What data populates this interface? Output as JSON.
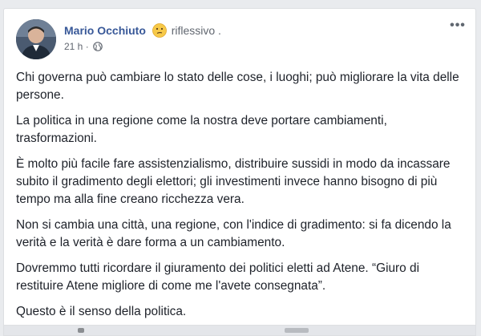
{
  "post": {
    "author": "Mario Occhiuto",
    "feeling_icon": "thinking-face-emoji",
    "feeling": "riflessivo .",
    "timestamp": "21 h ·",
    "audience_icon": "globe-icon",
    "more_icon": "more-options-icon",
    "avatar_icon": "profile-photo",
    "paragraphs": [
      "Chi governa può cambiare lo stato delle cose, i luoghi; può migliorare la vita delle persone.",
      "La politica in una regione come la nostra deve portare cambiamenti, trasformazioni.",
      "È molto più facile fare assistenzialismo, distribuire sussidi in modo da incassare subito il gradimento degli elettori; gli investimenti invece hanno bisogno di più tempo ma alla fine creano ricchezza vera.",
      "Non si cambia una città, una regione, con l'indice di gradimento: si fa dicendo la verità e la verità è dare forma a un cambiamento.",
      "Dovremmo tutti ricordare il giuramento dei politici eletti ad Atene. “Giuro di restituire Atene migliore di come me l'avete consegnata”.",
      "Questo è il senso della politica."
    ]
  },
  "colors": {
    "author_link": "#385898",
    "meta_text": "#616770",
    "body_text": "#1d2129",
    "background": "#e9ebee"
  }
}
